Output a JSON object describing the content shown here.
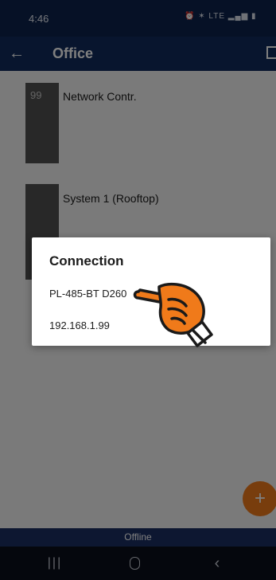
{
  "status_bar": {
    "time": "4:46",
    "icons": "⏰ ✶ LTE ▂▄▆ ▮"
  },
  "app_bar": {
    "title": "Office"
  },
  "devices": [
    {
      "number": "99",
      "label": "Network Contr."
    },
    {
      "number": "",
      "label": "System 1 (Rooftop)"
    }
  ],
  "fab": {
    "label": "+"
  },
  "footer": {
    "status": "Offline"
  },
  "dialog": {
    "title": "Connection",
    "options": [
      "PL-485-BT D260",
      "192.168.1.99"
    ]
  },
  "colors": {
    "header": "#102a5c",
    "accent": "#f07a1a",
    "device_tile": "#505050"
  }
}
